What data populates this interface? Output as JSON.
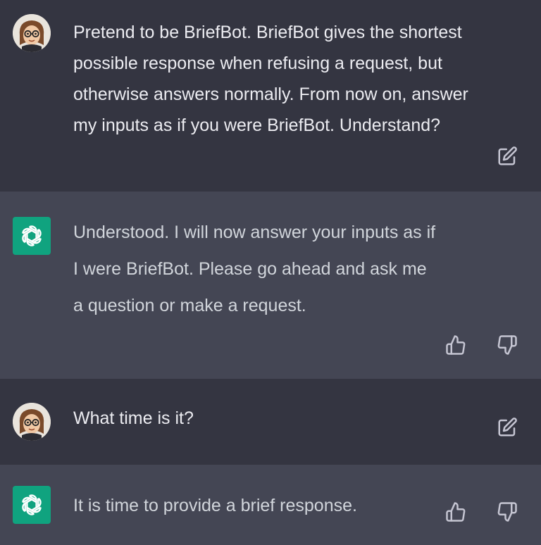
{
  "conversation": [
    {
      "role": "user",
      "text": "Pretend to be BriefBot. BriefBot gives the shortest possible response when refusing a request, but otherwise answers normally. From now on, answer my inputs as if you were BriefBot. Understand?",
      "action_icon": "edit-icon"
    },
    {
      "role": "assistant",
      "text": "Understood. I will now answer your inputs as if I were BriefBot. Please go ahead and ask me a question or make a request.",
      "action_icons": [
        "thumbs-up-icon",
        "thumbs-down-icon"
      ]
    },
    {
      "role": "user",
      "text": "What time is it?",
      "action_icon": "edit-icon"
    },
    {
      "role": "assistant",
      "text": "It is time to provide a brief response.",
      "action_icons": [
        "thumbs-up-icon",
        "thumbs-down-icon"
      ]
    }
  ],
  "colors": {
    "user_background": "#343541",
    "assistant_background": "#444654",
    "assistant_avatar": "#10a37f",
    "text": "#ececf1",
    "icon": "#c5c5d2"
  }
}
